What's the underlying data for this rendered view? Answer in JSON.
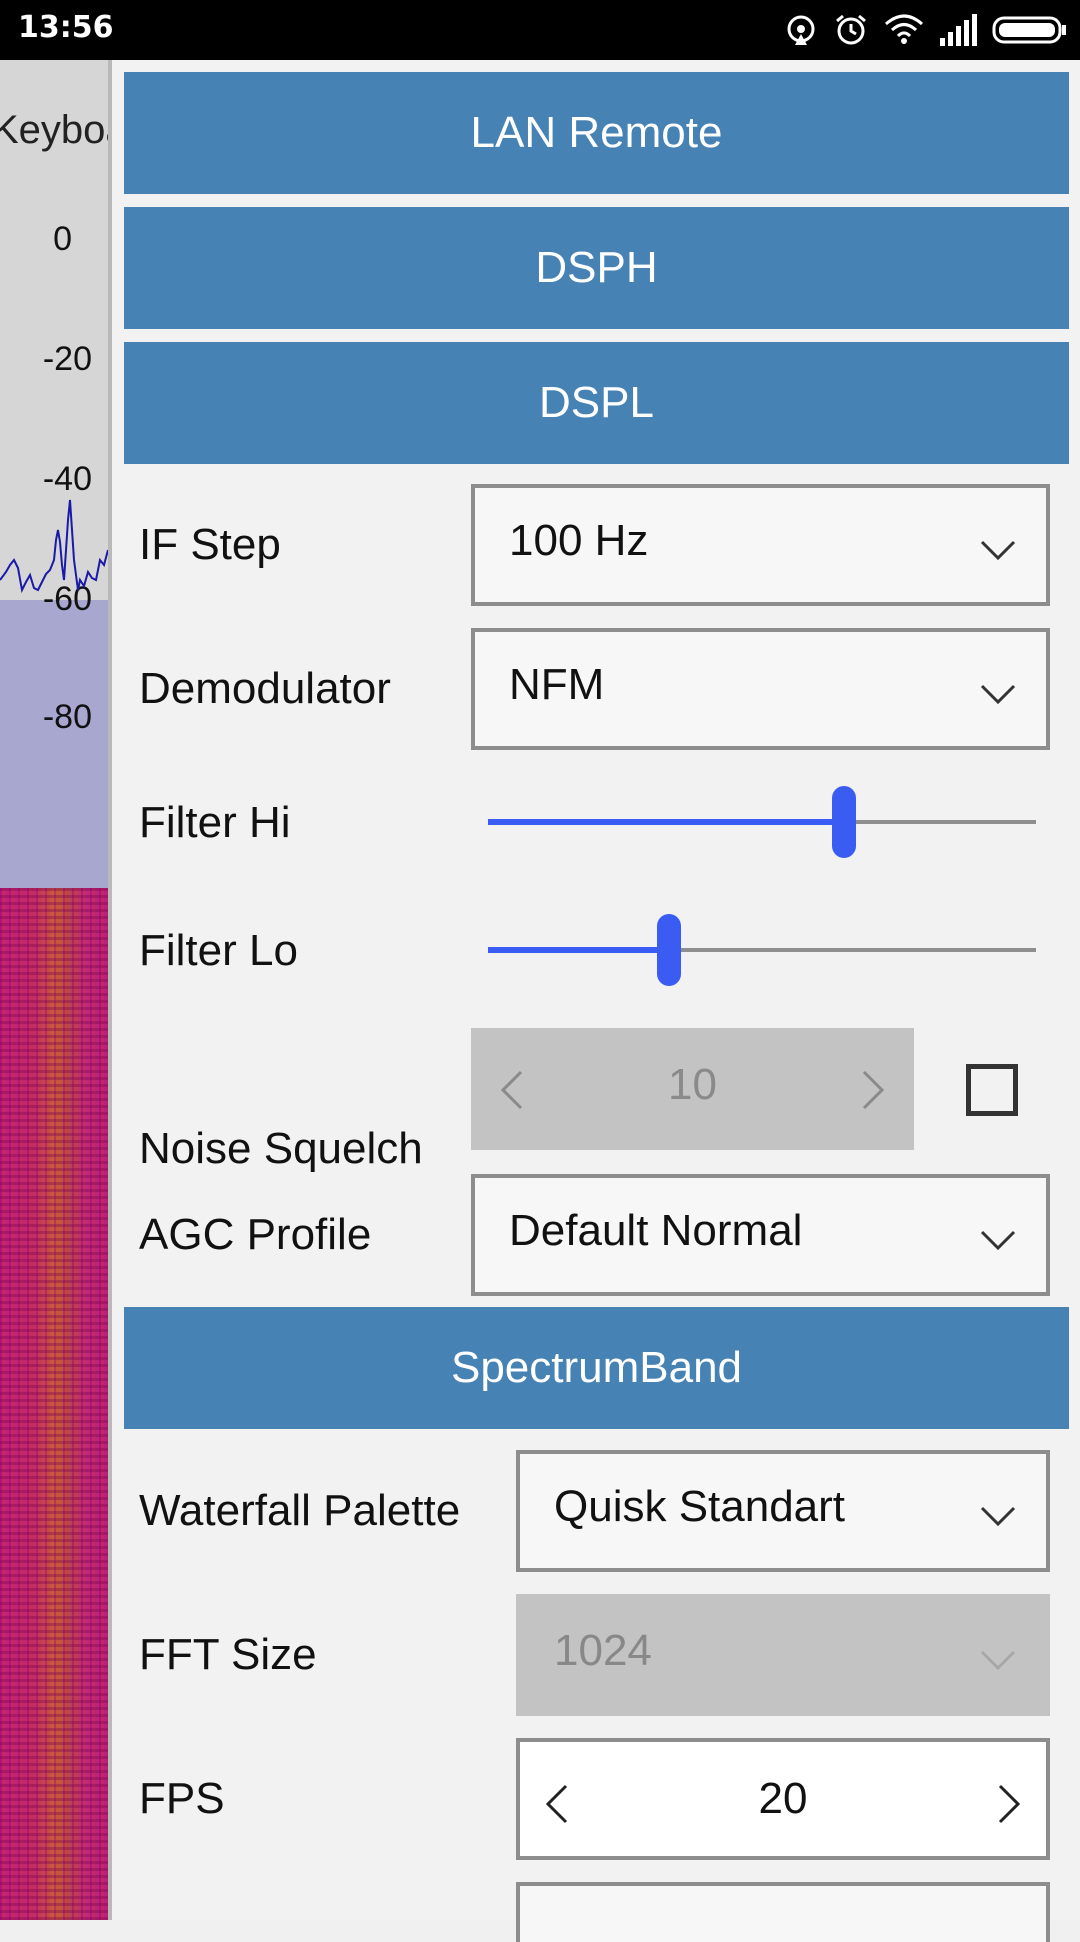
{
  "status_bar": {
    "time": "13:56"
  },
  "spectrum": {
    "label": "Keyboard",
    "db_ticks": [
      "0",
      "-20",
      "-40",
      "-60",
      "-80"
    ]
  },
  "sections": {
    "lan_remote": "LAN Remote",
    "dsph": "DSPH",
    "dspl": "DSPL",
    "spectrum_band": "SpectrumBand"
  },
  "dspl": {
    "if_step": {
      "label": "IF Step",
      "value": "100 Hz"
    },
    "demodulator": {
      "label": "Demodulator",
      "value": "NFM"
    },
    "filter_hi": {
      "label": "Filter Hi",
      "level": 0.65
    },
    "filter_lo": {
      "label": "Filter Lo",
      "level": 0.33
    },
    "noise_squelch": {
      "label": "Noise Squelch",
      "value": "10",
      "enabled": false
    },
    "agc_profile": {
      "label": "AGC Profile",
      "value": "Default Normal"
    }
  },
  "spectrum_band": {
    "waterfall_palette": {
      "label": "Waterfall Palette",
      "value": "Quisk Standart"
    },
    "fft_size": {
      "label": "FFT Size",
      "value": "1024"
    },
    "fps": {
      "label": "FPS",
      "value": "20"
    }
  },
  "colors": {
    "header": "#4682b4",
    "slider": "#3a5cf2",
    "status_bar": "#000000"
  }
}
